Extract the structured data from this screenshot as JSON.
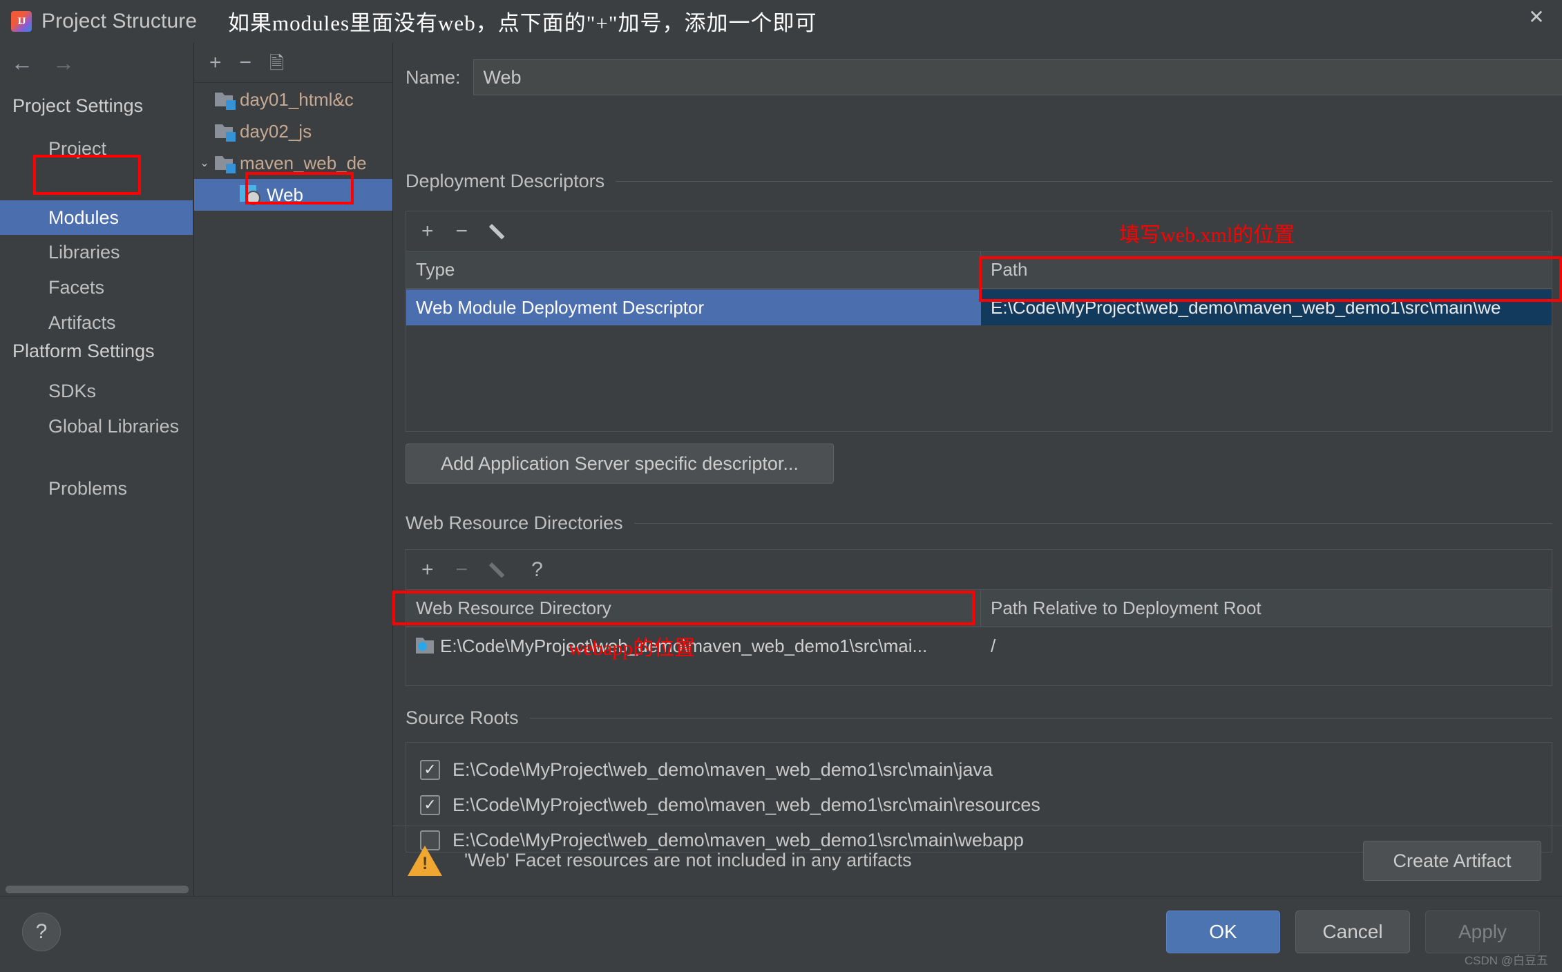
{
  "window": {
    "title": "Project Structure",
    "app_icon": "intellij-idea-icon",
    "close_icon": "✕"
  },
  "annotations": {
    "top_note": "如果modules里面没有web，点下面的\"+\"加号，添加一个即可",
    "path_note": "填写web.xml的位置",
    "webapp_note": "webapp的位置"
  },
  "sidebar": {
    "back_icon": "←",
    "forward_icon": "→",
    "groups": [
      {
        "label": "Project Settings"
      },
      {
        "label": "Platform Settings"
      }
    ],
    "items": [
      {
        "label": "Project",
        "selected": false
      },
      {
        "label": "Modules",
        "selected": true
      },
      {
        "label": "Libraries",
        "selected": false
      },
      {
        "label": "Facets",
        "selected": false
      },
      {
        "label": "Artifacts",
        "selected": false
      },
      {
        "label": "SDKs",
        "selected": false
      },
      {
        "label": "Global Libraries",
        "selected": false
      },
      {
        "label": "Problems",
        "selected": false
      }
    ]
  },
  "tree": {
    "toolbar": {
      "add": "+",
      "remove": "−",
      "copy": "copy-icon"
    },
    "rows": [
      {
        "label": "day01_html&c",
        "type": "module",
        "indent": 1,
        "chevron": "",
        "selected": false
      },
      {
        "label": "day02_js",
        "type": "module",
        "indent": 1,
        "chevron": "",
        "selected": false
      },
      {
        "label": "maven_web_de",
        "type": "module",
        "indent": 1,
        "chevron": "⌄",
        "selected": false
      },
      {
        "label": "Web",
        "type": "facet",
        "indent": 2,
        "chevron": "",
        "selected": true
      }
    ]
  },
  "main": {
    "name_label": "Name:",
    "name_value": "Web",
    "deployment": {
      "title": "Deployment Descriptors",
      "toolbar": {
        "add": "+",
        "remove": "−",
        "edit": "pencil-icon"
      },
      "columns": [
        "Type",
        "Path"
      ],
      "rows": [
        {
          "type": "Web Module Deployment Descriptor",
          "path": "E:\\Code\\MyProject\\web_demo\\maven_web_demo1\\src\\main\\we"
        }
      ],
      "add_button": "Add Application Server specific descriptor..."
    },
    "web_resources": {
      "title": "Web Resource Directories",
      "toolbar": {
        "add": "+",
        "remove": "−",
        "edit": "pencil-icon",
        "help": "?"
      },
      "columns": [
        "Web Resource Directory",
        "Path Relative to Deployment Root"
      ],
      "rows": [
        {
          "directory": "E:\\Code\\MyProject\\web_demo\\maven_web_demo1\\src\\mai...",
          "relative": "/"
        }
      ]
    },
    "source_roots": {
      "title": "Source Roots",
      "items": [
        {
          "path": "E:\\Code\\MyProject\\web_demo\\maven_web_demo1\\src\\main\\java",
          "checked": true
        },
        {
          "path": "E:\\Code\\MyProject\\web_demo\\maven_web_demo1\\src\\main\\resources",
          "checked": true
        },
        {
          "path": "E:\\Code\\MyProject\\web_demo\\maven_web_demo1\\src\\main\\webapp",
          "checked": false
        }
      ],
      "check_glyph": "✓"
    },
    "warning": {
      "icon": "warning-triangle-icon",
      "text": "'Web' Facet resources are not included in any artifacts",
      "action_label": "Create Artifact"
    }
  },
  "footer": {
    "help_label": "?",
    "ok_label": "OK",
    "cancel_label": "Cancel",
    "apply_label": "Apply"
  },
  "watermark": "CSDN @白豆五",
  "colors": {
    "accent_selection": "#4b6eaf",
    "annotation_red": "#ff0000",
    "warning_amber": "#f0a732",
    "panel_bg": "#3c3f41"
  }
}
